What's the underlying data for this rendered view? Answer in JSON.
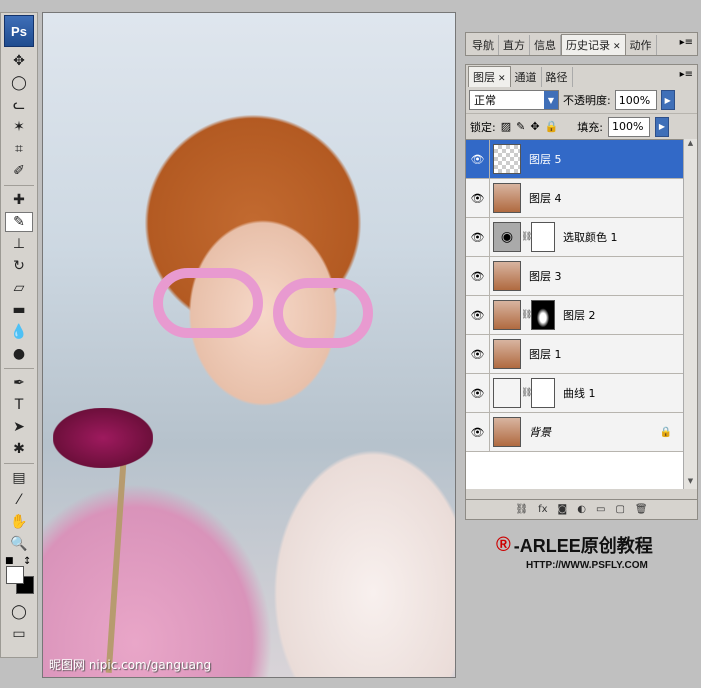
{
  "toolbox": {
    "logo": "Ps",
    "tools": [
      {
        "name": "move-tool-icon",
        "glyph": "✥"
      },
      {
        "name": "marquee-tool-icon",
        "glyph": "◯"
      },
      {
        "name": "lasso-tool-icon",
        "glyph": "ᓚ"
      },
      {
        "name": "magic-wand-tool-icon",
        "glyph": "✶"
      },
      {
        "name": "crop-tool-icon",
        "glyph": "⌗"
      },
      {
        "name": "slice-tool-icon",
        "glyph": "✐"
      },
      {
        "name": "healing-brush-tool-icon",
        "glyph": "✚"
      },
      {
        "name": "brush-tool-icon",
        "glyph": "✎"
      },
      {
        "name": "stamp-tool-icon",
        "glyph": "⊥"
      },
      {
        "name": "history-brush-tool-icon",
        "glyph": "↻"
      },
      {
        "name": "eraser-tool-icon",
        "glyph": "▱"
      },
      {
        "name": "gradient-tool-icon",
        "glyph": "▬"
      },
      {
        "name": "blur-tool-icon",
        "glyph": "💧"
      },
      {
        "name": "dodge-tool-icon",
        "glyph": "●"
      },
      {
        "name": "pen-tool-icon",
        "glyph": "✒"
      },
      {
        "name": "type-tool-icon",
        "glyph": "T"
      },
      {
        "name": "path-selection-tool-icon",
        "glyph": "➤"
      },
      {
        "name": "shape-tool-icon",
        "glyph": "✱"
      },
      {
        "name": "notes-tool-icon",
        "glyph": "▤"
      },
      {
        "name": "eyedropper-tool-icon",
        "glyph": "⁄"
      },
      {
        "name": "hand-tool-icon",
        "glyph": "✋"
      },
      {
        "name": "zoom-tool-icon",
        "glyph": "🔍"
      }
    ],
    "active_tool": "brush-tool-icon",
    "quick_mask_icon": "◯",
    "screen_mode_icon": "▭"
  },
  "canvas": {
    "watermark": "昵图网 nipic.com/ganguang"
  },
  "history_panel": {
    "tabs": [
      "导航",
      "直方",
      "信息",
      "历史记录",
      "动作"
    ],
    "selected_tab": "历史记录"
  },
  "layers_panel": {
    "tabs": [
      "图层",
      "通道",
      "路径"
    ],
    "selected_tab": "图层",
    "blend_mode": "正常",
    "opacity_label": "不透明度:",
    "opacity_value": "100%",
    "lock_label": "锁定:",
    "fill_label": "填充:",
    "fill_value": "100%",
    "layers": [
      {
        "name": "图层 5",
        "selected": true
      },
      {
        "name": "图层 4",
        "selected": false
      },
      {
        "name": "选取颜色 1",
        "selected": false
      },
      {
        "name": "图层 3",
        "selected": false
      },
      {
        "name": "图层 2",
        "selected": false
      },
      {
        "name": "图层 1",
        "selected": false
      },
      {
        "name": "曲线 1",
        "selected": false
      },
      {
        "name": "背景",
        "selected": false,
        "locked": true
      }
    ],
    "brand_title": "-ARLEE原创教程",
    "brand_symbol": "®",
    "brand_url": "HTTP://WWW.PSFLY.COM"
  },
  "colors": {
    "selection_blue": "#3269c7",
    "foreground": "#ffffff",
    "background": "#000000"
  }
}
